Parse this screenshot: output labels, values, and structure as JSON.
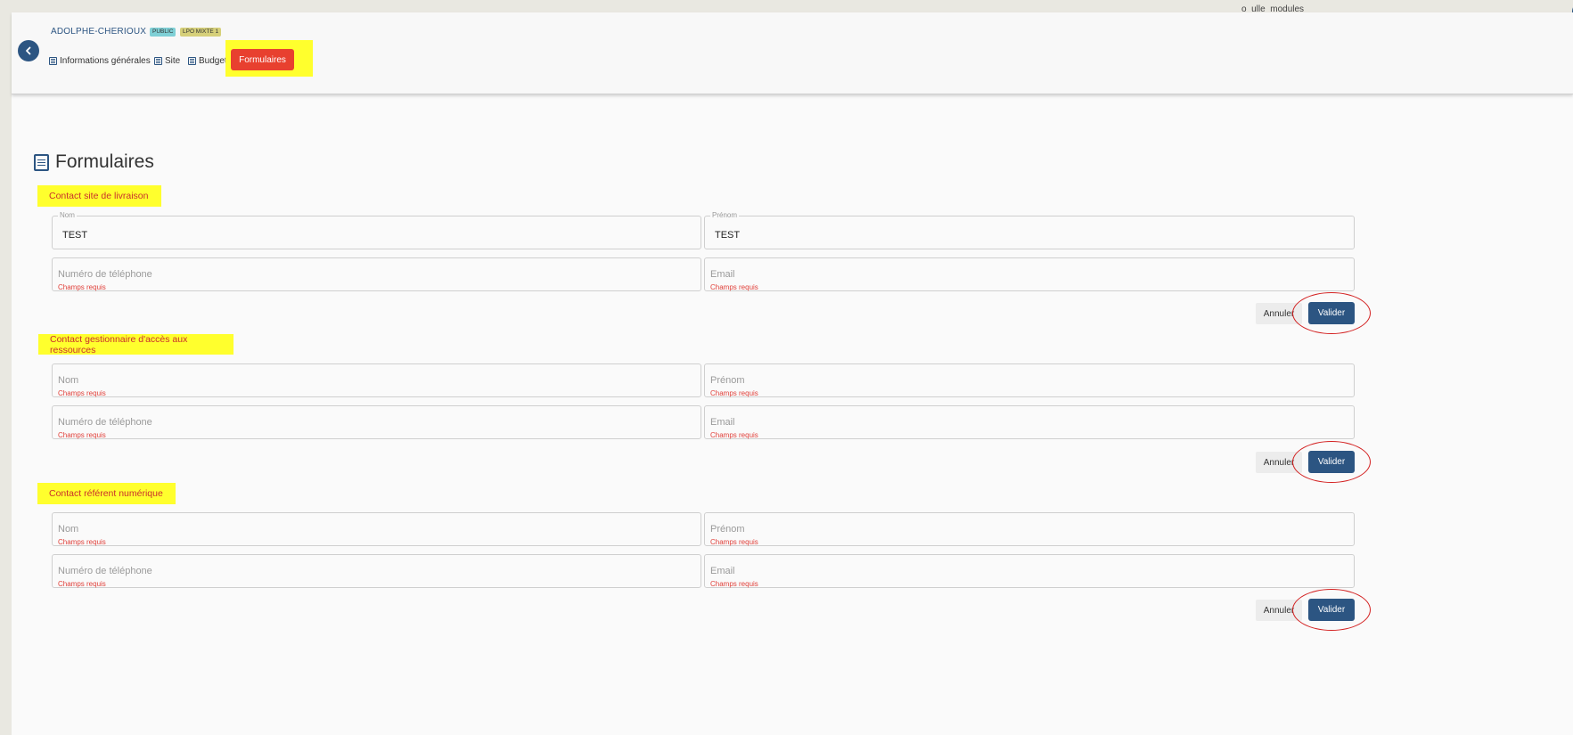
{
  "header": {
    "school_name": "ADOLPHE-CHERIOUX",
    "badges": [
      "PUBLIC",
      "LPO MIXTE 1"
    ],
    "tabs": [
      {
        "label": "Informations générales"
      },
      {
        "label": "Site"
      },
      {
        "label": "Budget"
      },
      {
        "label": "Formulaires",
        "active": true
      }
    ],
    "topbar_text": "o_ulle_modules"
  },
  "page": {
    "title": "Formulaires"
  },
  "sections": [
    {
      "title": "Contact site de livraison",
      "fields": [
        {
          "label": "Nom",
          "value": "TEST"
        },
        {
          "label": "Prénom",
          "value": "TEST"
        },
        {
          "label": "Numéro de téléphone",
          "value": "",
          "error": "Champs requis"
        },
        {
          "label": "Email",
          "value": "",
          "error": "Champs requis"
        }
      ],
      "cancel_label": "Annuler",
      "submit_label": "Valider"
    },
    {
      "title": "Contact gestionnaire d'accès aux ressources",
      "fields": [
        {
          "label": "Nom",
          "value": "",
          "error": "Champs requis"
        },
        {
          "label": "Prénom",
          "value": "",
          "error": "Champs requis"
        },
        {
          "label": "Numéro de téléphone",
          "value": "",
          "error": "Champs requis"
        },
        {
          "label": "Email",
          "value": "",
          "error": "Champs requis"
        }
      ],
      "cancel_label": "Annuler",
      "submit_label": "Valider"
    },
    {
      "title": "Contact référent numérique",
      "fields": [
        {
          "label": "Nom",
          "value": "",
          "error": "Champs requis"
        },
        {
          "label": "Prénom",
          "value": "",
          "error": "Champs requis"
        },
        {
          "label": "Numéro de téléphone",
          "value": "",
          "error": "Champs requis"
        },
        {
          "label": "Email",
          "value": "",
          "error": "Champs requis"
        }
      ],
      "cancel_label": "Annuler",
      "submit_label": "Valider"
    }
  ],
  "colors": {
    "primary": "#2c5582",
    "active_tab": "#e8402f",
    "highlight": "#ffff2d",
    "error": "#e0403a",
    "annotation_circle": "#d32020"
  }
}
